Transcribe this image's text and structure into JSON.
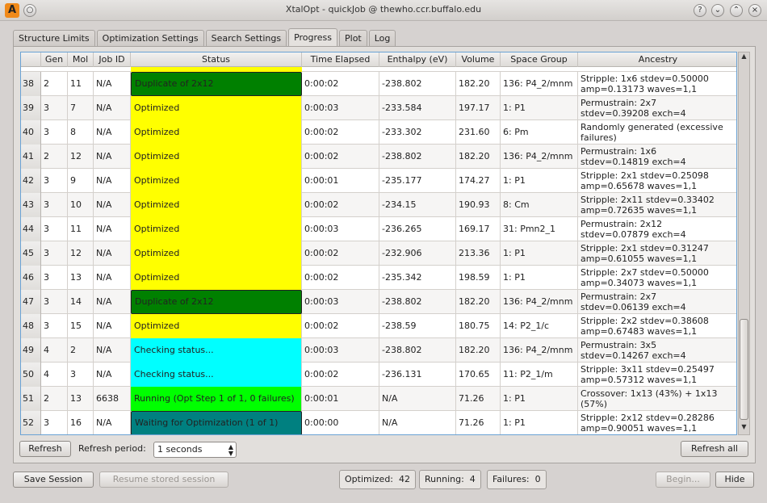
{
  "window": {
    "title": "XtalOpt - quickJob @ thewho.ccr.buffalo.edu"
  },
  "tabs": [
    {
      "label": "Structure Limits"
    },
    {
      "label": "Optimization Settings"
    },
    {
      "label": "Search Settings"
    },
    {
      "label": "Progress"
    },
    {
      "label": "Plot"
    },
    {
      "label": "Log"
    }
  ],
  "table": {
    "columns": [
      "",
      "Gen",
      "Mol",
      "Job ID",
      "Status",
      "Time Elapsed",
      "Enthalpy (eV)",
      "Volume",
      "Space Group",
      "Ancestry"
    ],
    "rows": [
      {
        "idx": "38",
        "gen": "2",
        "mol": "11",
        "job": "N/A",
        "status": "Duplicate of 2x12",
        "kind": "duplicate",
        "time": "0:00:02",
        "enthalpy": "-238.802",
        "volume": "182.20",
        "sg": "136: P4_2/mnm",
        "anc1": "Stripple: 1x6 stdev=0.50000",
        "anc2": "amp=0.13173 waves=1,1"
      },
      {
        "idx": "39",
        "gen": "3",
        "mol": "7",
        "job": "N/A",
        "status": "Optimized",
        "kind": "optimized",
        "time": "0:00:03",
        "enthalpy": "-233.584",
        "volume": "197.17",
        "sg": "1: P1",
        "anc1": "Permustrain: 2x7",
        "anc2": "stdev=0.39208 exch=4"
      },
      {
        "idx": "40",
        "gen": "3",
        "mol": "8",
        "job": "N/A",
        "status": "Optimized",
        "kind": "optimized",
        "time": "0:00:02",
        "enthalpy": "-233.302",
        "volume": "231.60",
        "sg": "6: Pm",
        "anc1": "Randomly generated (excessive",
        "anc2": "failures)"
      },
      {
        "idx": "41",
        "gen": "2",
        "mol": "12",
        "job": "N/A",
        "status": "Optimized",
        "kind": "optimized",
        "time": "0:00:02",
        "enthalpy": "-238.802",
        "volume": "182.20",
        "sg": "136: P4_2/mnm",
        "anc1": "Permustrain: 1x6",
        "anc2": "stdev=0.14819 exch=4"
      },
      {
        "idx": "42",
        "gen": "3",
        "mol": "9",
        "job": "N/A",
        "status": "Optimized",
        "kind": "optimized",
        "time": "0:00:01",
        "enthalpy": "-235.177",
        "volume": "174.27",
        "sg": "1: P1",
        "anc1": "Stripple: 2x1 stdev=0.25098",
        "anc2": "amp=0.65678 waves=1,1"
      },
      {
        "idx": "43",
        "gen": "3",
        "mol": "10",
        "job": "N/A",
        "status": "Optimized",
        "kind": "optimized",
        "time": "0:00:02",
        "enthalpy": "-234.15",
        "volume": "190.93",
        "sg": "8: Cm",
        "anc1": "Stripple: 2x11 stdev=0.33402",
        "anc2": "amp=0.72635 waves=1,1"
      },
      {
        "idx": "44",
        "gen": "3",
        "mol": "11",
        "job": "N/A",
        "status": "Optimized",
        "kind": "optimized",
        "time": "0:00:03",
        "enthalpy": "-236.265",
        "volume": "169.17",
        "sg": "31: Pmn2_1",
        "anc1": "Permustrain: 2x12",
        "anc2": "stdev=0.07879 exch=4"
      },
      {
        "idx": "45",
        "gen": "3",
        "mol": "12",
        "job": "N/A",
        "status": "Optimized",
        "kind": "optimized",
        "time": "0:00:02",
        "enthalpy": "-232.906",
        "volume": "213.36",
        "sg": "1: P1",
        "anc1": "Stripple: 2x1 stdev=0.31247",
        "anc2": "amp=0.61055 waves=1,1"
      },
      {
        "idx": "46",
        "gen": "3",
        "mol": "13",
        "job": "N/A",
        "status": "Optimized",
        "kind": "optimized",
        "time": "0:00:02",
        "enthalpy": "-235.342",
        "volume": "198.59",
        "sg": "1: P1",
        "anc1": "Stripple: 2x7 stdev=0.50000",
        "anc2": "amp=0.34073 waves=1,1"
      },
      {
        "idx": "47",
        "gen": "3",
        "mol": "14",
        "job": "N/A",
        "status": "Duplicate of 2x12",
        "kind": "duplicate",
        "time": "0:00:03",
        "enthalpy": "-238.802",
        "volume": "182.20",
        "sg": "136: P4_2/mnm",
        "anc1": "Permustrain: 2x7",
        "anc2": "stdev=0.06139 exch=4"
      },
      {
        "idx": "48",
        "gen": "3",
        "mol": "15",
        "job": "N/A",
        "status": "Optimized",
        "kind": "optimized",
        "time": "0:00:02",
        "enthalpy": "-238.59",
        "volume": "180.75",
        "sg": "14: P2_1/c",
        "anc1": "Stripple: 2x2 stdev=0.38608",
        "anc2": "amp=0.67483 waves=1,1"
      },
      {
        "idx": "49",
        "gen": "4",
        "mol": "2",
        "job": "N/A",
        "status": "Checking status...",
        "kind": "checking",
        "time": "0:00:03",
        "enthalpy": "-238.802",
        "volume": "182.20",
        "sg": "136: P4_2/mnm",
        "anc1": "Permustrain: 3x5",
        "anc2": "stdev=0.14267 exch=4"
      },
      {
        "idx": "50",
        "gen": "4",
        "mol": "3",
        "job": "N/A",
        "status": "Checking status...",
        "kind": "checking",
        "time": "0:00:02",
        "enthalpy": "-236.131",
        "volume": "170.65",
        "sg": "11: P2_1/m",
        "anc1": "Stripple: 3x11 stdev=0.25497",
        "anc2": "amp=0.57312 waves=1,1"
      },
      {
        "idx": "51",
        "gen": "2",
        "mol": "13",
        "job": "6638",
        "status": "Running (Opt Step 1 of 1, 0 failures)",
        "kind": "running",
        "time": "0:00:01",
        "enthalpy": "N/A",
        "volume": "71.26",
        "sg": "1: P1",
        "anc1": "Crossover: 1x13 (43%) + 1x13",
        "anc2": "(57%)"
      },
      {
        "idx": "52",
        "gen": "3",
        "mol": "16",
        "job": "N/A",
        "status": "Waiting for Optimization (1 of 1)",
        "kind": "waiting",
        "time": "0:00:00",
        "enthalpy": "N/A",
        "volume": "71.26",
        "sg": "1: P1",
        "anc1": "Stripple: 2x12 stdev=0.28286",
        "anc2": "amp=0.90051 waves=1,1"
      }
    ]
  },
  "status_colors": {
    "optimized": "#ffff00",
    "duplicate": "#008000",
    "checking": "#00ffff",
    "running": "#00ff00",
    "waiting": "#008080"
  },
  "controls": {
    "refresh": "Refresh",
    "refresh_period_label": "Refresh period:",
    "refresh_period_value": "1 seconds",
    "refresh_all": "Refresh all"
  },
  "bottom": {
    "save_session": "Save Session",
    "resume_session": "Resume stored session",
    "optimized_label": "Optimized:",
    "optimized_value": "42",
    "running_label": "Running:",
    "running_value": "4",
    "failures_label": "Failures:",
    "failures_value": "0",
    "begin": "Begin...",
    "hide": "Hide"
  }
}
